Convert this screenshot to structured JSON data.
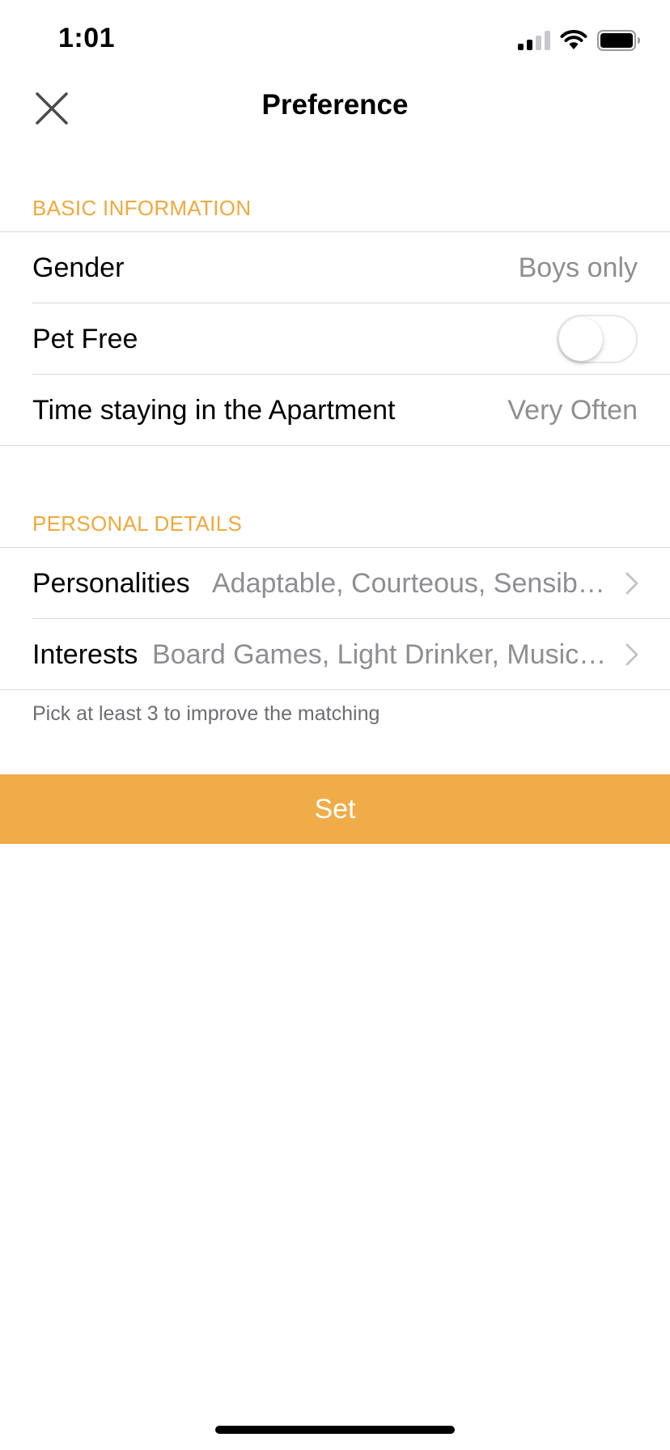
{
  "status_bar": {
    "time": "1:01",
    "icons": [
      "cellular-signal-icon",
      "wifi-icon",
      "battery-icon"
    ]
  },
  "nav": {
    "title": "Preference",
    "close_icon": "close-icon"
  },
  "basic_information": {
    "header": "BASIC INFORMATION",
    "gender": {
      "label": "Gender",
      "value": "Boys only"
    },
    "pet_free": {
      "label": "Pet Free",
      "enabled": false
    },
    "time_staying": {
      "label": "Time staying in the Apartment",
      "value": "Very Often"
    }
  },
  "personal_details": {
    "header": "PERSONAL DETAILS",
    "personalities": {
      "label": "Personalities",
      "value": "Adaptable, Courteous, Sensible, ..."
    },
    "interests": {
      "label": "Interests",
      "value": "Board Games, Light Drinker, Music, ..."
    },
    "helper": "Pick at least 3 to improve the matching"
  },
  "actions": {
    "set_label": "Set"
  },
  "colors": {
    "accent": "#f0ac48",
    "section_header": "#f0a93c",
    "secondary_text": "#8e8e93",
    "divider": "#d8d8d8"
  }
}
